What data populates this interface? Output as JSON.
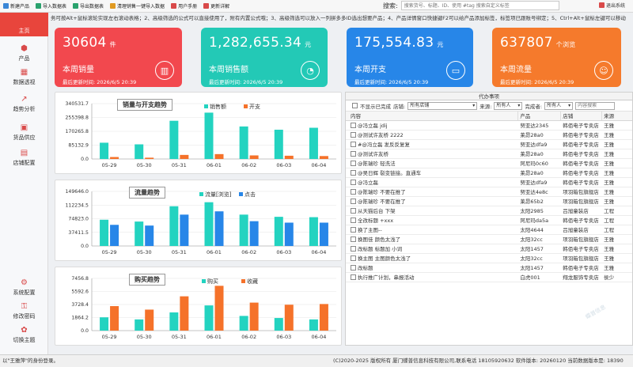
{
  "toolbar": {
    "buttons": [
      {
        "label": "新建产品",
        "color": "#3a86d6"
      },
      {
        "label": "导入数据表",
        "color": "#2aa26d"
      },
      {
        "label": "导出数据表",
        "color": "#2aa26d"
      },
      {
        "label": "清理销售一键导入数据",
        "color": "#e09a22"
      },
      {
        "label": "用户手册",
        "color": "#d94a4a"
      },
      {
        "label": "更新详解",
        "color": "#d94a4a"
      }
    ],
    "search_label": "搜索:",
    "search_placeholder": "搜索货号、标题、ID、使用 #tag 搜索自定义标签",
    "reload_label": "退出系统"
  },
  "sidebar": {
    "items": [
      {
        "label": "主页",
        "icon": "⌂"
      },
      {
        "label": "产品",
        "icon": "⬢"
      },
      {
        "label": "数据透视",
        "icon": "▦"
      },
      {
        "label": "趋势分析",
        "icon": "↗"
      },
      {
        "label": "货品供应",
        "icon": "▣"
      },
      {
        "label": "店铺配置",
        "icon": "▤"
      },
      {
        "label": "系统配置",
        "icon": "⚙"
      },
      {
        "label": "修改密码",
        "icon": "⚿"
      },
      {
        "label": "切换主题",
        "icon": "✿"
      }
    ]
  },
  "ticker": "务可按Alt+鼠标滚轮实现左右滚动表格；2、高级筛选的公式可以直接使用了，附有内置公式哦；3、高级筛选可以放入一列拼多多ID选出想要产品；4、产品详情窗口快捷键F2可以给产品添加标签，标签项已跟账号绑定；5、Ctrl+Alt+鼠标左键可以移动",
  "cards": [
    {
      "value": "30604",
      "unit": "件",
      "label": "本周销量",
      "updated": "最后更新时间: 2026/6/5 20:39",
      "color": "#f2484e",
      "icon": "▥"
    },
    {
      "value": "1,282,655.34",
      "unit": "元",
      "label": "本周销售额",
      "updated": "最后更新时间: 2026/6/5 20:39",
      "color": "#23c9b6",
      "icon": "◔"
    },
    {
      "value": "175,554.83",
      "unit": "元",
      "label": "本周开支",
      "updated": "最后更新时间: 2026/6/5 20:39",
      "color": "#2786e8",
      "icon": "▭"
    },
    {
      "value": "637807",
      "unit": "个浏览",
      "label": "本周流量",
      "updated": "最后更新时间: 2026/6/5 20:39",
      "color": "#f57a2c",
      "icon": "☺"
    }
  ],
  "chart_data": [
    {
      "type": "bar",
      "title": "销量与开支趋势",
      "categories": [
        "05-29",
        "05-30",
        "05-31",
        "06-01",
        "06-02",
        "06-03",
        "06-04"
      ],
      "yticks": [
        "340531.7",
        "255398.8",
        "170265.8",
        "85132.9",
        "0.0"
      ],
      "ylim": [
        0,
        340531.7
      ],
      "series": [
        {
          "name": "销售额",
          "color": "#23d3c0",
          "values": [
            100000,
            90000,
            235000,
            285000,
            200000,
            180000,
            192000
          ]
        },
        {
          "name": "开支",
          "color": "#f5722a",
          "values": [
            12000,
            8000,
            25000,
            30000,
            22000,
            20000,
            18000
          ]
        }
      ]
    },
    {
      "type": "bar",
      "title": "流量趋势",
      "categories": [
        "05-29",
        "05-30",
        "05-31",
        "06-01",
        "06-02",
        "06-03",
        "06-04"
      ],
      "yticks": [
        "149646.0",
        "112234.5",
        "74823.0",
        "37411.5",
        "0.0"
      ],
      "ylim": [
        0,
        149646
      ],
      "series": [
        {
          "name": "流量[浏览]",
          "color": "#23d3c0",
          "values": [
            72000,
            67000,
            109000,
            120000,
            86000,
            80000,
            79000
          ]
        },
        {
          "name": "点击",
          "color": "#2786e8",
          "values": [
            58000,
            56000,
            86000,
            95000,
            68000,
            64000,
            64000
          ]
        }
      ]
    },
    {
      "type": "bar",
      "title": "购买趋势",
      "categories": [
        "05-29",
        "05-30",
        "05-31",
        "06-01",
        "06-02",
        "06-03",
        "06-04"
      ],
      "yticks": [
        "7456.8",
        "5592.6",
        "3728.4",
        "1864.2",
        "0.0"
      ],
      "ylim": [
        0,
        7456.8
      ],
      "series": [
        {
          "name": "购买",
          "color": "#23d3c0",
          "values": [
            1900,
            1600,
            2600,
            3600,
            2100,
            1800,
            1600
          ]
        },
        {
          "name": "收藏",
          "color": "#f5722a",
          "values": [
            3500,
            3000,
            4900,
            6400,
            4000,
            3700,
            3800
          ]
        }
      ]
    }
  ],
  "todo": {
    "title": "代办事项",
    "hide_done": "不显示已完成",
    "shop_label": "店铺:",
    "shop_value": "所有店铺",
    "source_label": "来源:",
    "source_value": "所有人",
    "finisher_label": "完成者:",
    "finisher_value": "所有人",
    "search_placeholder": "内容搜索",
    "columns": [
      "内容",
      "产品",
      "店铺",
      "来源"
    ],
    "rows": [
      {
        "content": "@冯立磊 jdij",
        "product": "努亚达2345",
        "shop": "韩佰电子专卖店",
        "source": "王雅"
      },
      {
        "content": "@测试许友桥 2222",
        "product": "莱昂28a0",
        "shop": "韩佰电子专卖店",
        "source": "王雅"
      },
      {
        "content": "#@冯立磊 发反反复复",
        "product": "努亚达dfa9",
        "shop": "韩佰电子专卖店",
        "source": "王雅"
      },
      {
        "content": "@测试许友桥",
        "product": "莱昂28a0",
        "shop": "韩佰电子专卖店",
        "source": "王雅"
      },
      {
        "content": "@陈瑞珍 轻洗法",
        "product": "阿尼玛0c60",
        "shop": "韩佰电子专卖店",
        "source": "王雅"
      },
      {
        "content": "@吴日辉 裂变链接。直通车",
        "product": "莱昂28a0",
        "shop": "韩佰电子专卖店",
        "source": "王雅"
      },
      {
        "content": "@冯立磊",
        "product": "努亚达dfa9",
        "shop": "韩佰电子专卖店",
        "source": "王雅"
      },
      {
        "content": "@陈瑞珍 不要在推了",
        "product": "努亚达4e8c",
        "shop": "项羽箱包旗舰店",
        "source": "王雅"
      },
      {
        "content": "@陈瑞珍 不要在推了",
        "product": "莱昂65b2",
        "shop": "项羽箱包旗舰店",
        "source": "王雅"
      },
      {
        "content": "从天猫后台 下架",
        "product": "太阳2985",
        "shop": "吕旭童装店",
        "source": "工程"
      },
      {
        "content": "全改标题 +xxx",
        "product": "阿尼玛da5a",
        "shop": "韩佰电子专卖店",
        "source": "工程"
      },
      {
        "content": "换了主图--",
        "product": "太阳4644",
        "shop": "吕旭童装店",
        "source": "工程"
      },
      {
        "content": "换图佳 颜色太浅了",
        "product": "太阳32cc",
        "shop": "项羽箱包旗舰店",
        "source": "王雅"
      },
      {
        "content": "改标题 标题加 小词",
        "product": "太阳1457",
        "shop": "韩佰电子专卖店",
        "source": "王雅"
      },
      {
        "content": "换主图 主图颜色太浅了",
        "product": "太阳32cc",
        "shop": "项羽箱包旗舰店",
        "source": "王雅"
      },
      {
        "content": "改标题",
        "product": "太阳1457",
        "shop": "韩佰电子专卖店",
        "source": "王雅"
      },
      {
        "content": "执行推广计划，串报活动",
        "product": "白虎001",
        "shop": "翔龙服饰专卖店",
        "source": "侯少"
      }
    ]
  },
  "watermark": "蝶普信息",
  "status": {
    "left": "以\"王雅萍\"的身份登录。",
    "right": "(C)2020-2025 版权所有 厦门蝶普信息科技有限公司,联系电话 18105920632  软件版本: 20260120  当前数据版本是: 18390"
  }
}
